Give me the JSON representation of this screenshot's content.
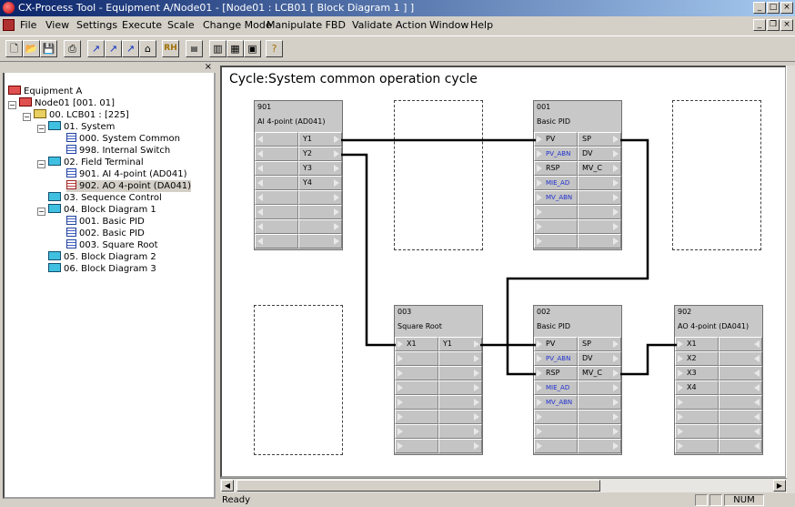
{
  "window": {
    "title": "CX-Process Tool - Equipment A/Node01 - [Node01 : LCB01  [ Block Diagram 1 ] ]"
  },
  "menu": [
    "File",
    "View",
    "Settings",
    "Execute",
    "Scale",
    "Change Mode",
    "Manipulate FBD",
    "Validate Action",
    "Window",
    "Help"
  ],
  "tree": [
    {
      "label": "Equipment A"
    },
    {
      "label": "Node01 [001. 01]"
    },
    {
      "label": "00. LCB01 : [225]"
    },
    {
      "label": "01. System"
    },
    {
      "label": "000. System Common"
    },
    {
      "label": "998. Internal Switch"
    },
    {
      "label": "02. Field Terminal"
    },
    {
      "label": "901. AI 4-point (AD041)"
    },
    {
      "label": "902. AO 4-point (DA041)"
    },
    {
      "label": "03. Sequence Control"
    },
    {
      "label": "04. Block Diagram 1"
    },
    {
      "label": "001. Basic PID"
    },
    {
      "label": "002. Basic PID"
    },
    {
      "label": "003. Square Root"
    },
    {
      "label": "05. Block Diagram 2"
    },
    {
      "label": "06. Block Diagram 3"
    }
  ],
  "canvas": {
    "heading": "Cycle:System common operation cycle"
  },
  "blocks": [
    {
      "num": "901",
      "name": "AI 4-point (AD041)",
      "rows": [
        [
          "",
          "Y1"
        ],
        [
          "",
          "Y2"
        ],
        [
          "",
          "Y3"
        ],
        [
          "",
          "Y4"
        ],
        [
          "",
          ""
        ],
        [
          "",
          ""
        ],
        [
          "",
          ""
        ],
        [
          "",
          ""
        ]
      ]
    },
    {
      "num": "001",
      "name": "Basic PID",
      "rows": [
        [
          "PV",
          "SP"
        ],
        [
          "PV_ABN",
          "DV"
        ],
        [
          "RSP",
          "MV_C"
        ],
        [
          "MIE_AD",
          ""
        ],
        [
          "MV_ABN",
          ""
        ],
        [
          "",
          ""
        ],
        [
          "",
          ""
        ],
        [
          "",
          ""
        ]
      ]
    },
    {
      "num": "003",
      "name": "Square Root",
      "rows": [
        [
          "X1",
          "Y1"
        ],
        [
          "",
          ""
        ],
        [
          "",
          ""
        ],
        [
          "",
          ""
        ],
        [
          "",
          ""
        ],
        [
          "",
          ""
        ],
        [
          "",
          ""
        ],
        [
          "",
          ""
        ]
      ]
    },
    {
      "num": "002",
      "name": "Basic PID",
      "rows": [
        [
          "PV",
          "SP"
        ],
        [
          "PV_ABN",
          "DV"
        ],
        [
          "RSP",
          "MV_C"
        ],
        [
          "MIE_AD",
          ""
        ],
        [
          "MV_ABN",
          ""
        ],
        [
          "",
          ""
        ],
        [
          "",
          ""
        ],
        [
          "",
          ""
        ]
      ]
    },
    {
      "num": "902",
      "name": "AO 4-point (DA041)",
      "rows": [
        [
          "X1",
          ""
        ],
        [
          "X2",
          ""
        ],
        [
          "X3",
          ""
        ],
        [
          "X4",
          ""
        ],
        [
          "",
          ""
        ],
        [
          "",
          ""
        ],
        [
          "",
          ""
        ],
        [
          "",
          ""
        ]
      ]
    }
  ],
  "status": {
    "text": "Ready",
    "num": "NUM"
  }
}
